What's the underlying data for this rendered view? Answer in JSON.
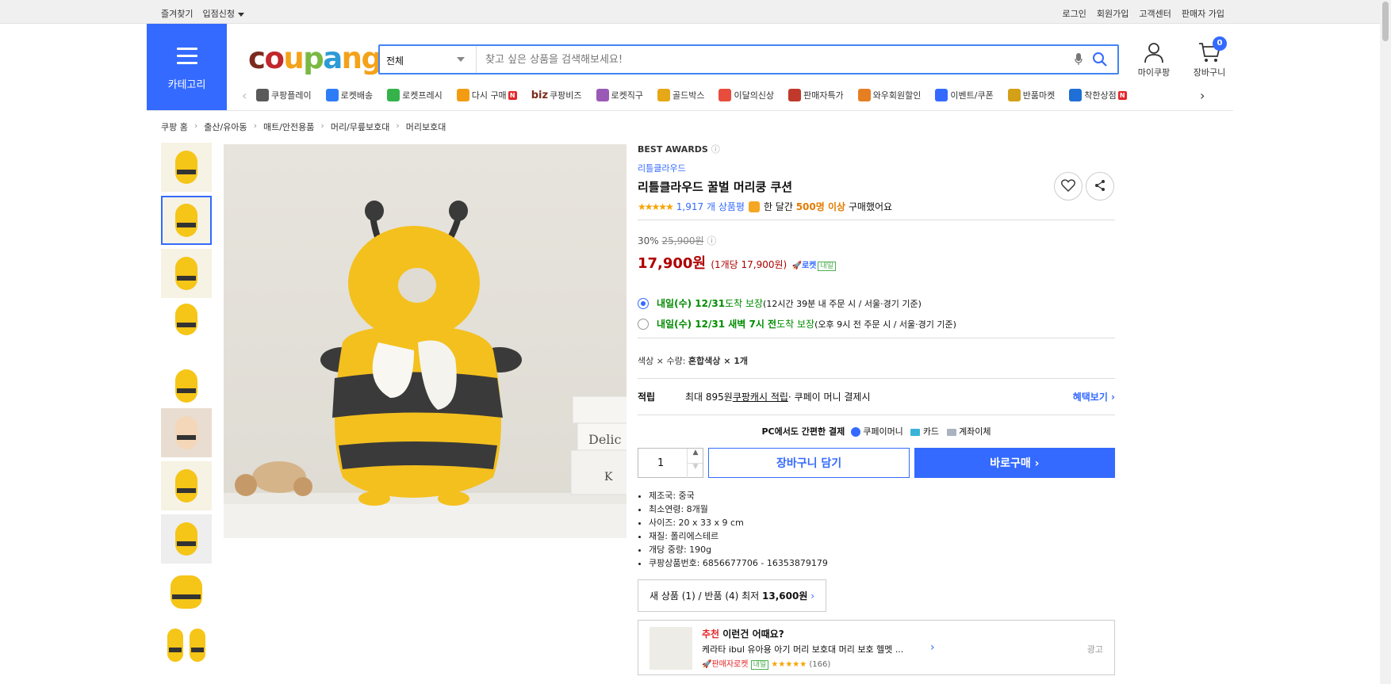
{
  "topbar": {
    "left": [
      "즐겨찾기",
      "입점신청"
    ],
    "right": [
      "로그인",
      "회원가입",
      "고객센터",
      "판매자 가입"
    ]
  },
  "header": {
    "category_label": "카테고리",
    "logo": [
      "c",
      "o",
      "u",
      "p",
      "a",
      "ng"
    ],
    "search": {
      "category": "전체",
      "placeholder": "찾고 싶은 상품을 검색해보세요!"
    },
    "mycoupang": "마이쿠팡",
    "cart": "장바구니",
    "cart_count": "0"
  },
  "nav": [
    {
      "label": "쿠팡플레이",
      "color": "#5a5a5a"
    },
    {
      "label": "로켓배송",
      "color": "#2f7df6"
    },
    {
      "label": "로켓프레시",
      "color": "#35b34a"
    },
    {
      "label": "다시 구매",
      "color": "#f39c12",
      "badge": "N"
    },
    {
      "label": "쿠팡비즈",
      "color": "#222",
      "prefix": "biz"
    },
    {
      "label": "로켓직구",
      "color": "#9b59b6"
    },
    {
      "label": "골드박스",
      "color": "#e6a817"
    },
    {
      "label": "이달의신상",
      "color": "#e74c3c"
    },
    {
      "label": "판매자특가",
      "color": "#c0392b"
    },
    {
      "label": "와우회원할인",
      "color": "#e67e22"
    },
    {
      "label": "이벤트/쿠폰",
      "color": "#346aff"
    },
    {
      "label": "반품마켓",
      "color": "#d4a017"
    },
    {
      "label": "착한상점",
      "color": "#1f6fd6",
      "badge": "N"
    }
  ],
  "breadcrumb": [
    "쿠팡 홈",
    "출산/유아동",
    "매트/안전용품",
    "머리/무릎보호대",
    "머리보호대"
  ],
  "product": {
    "awards": "BEST AWARDS",
    "brand": "리틀클라우드",
    "title": "리틀클라우드 꿀벌 머리쿵 쿠션",
    "stars": "★★★★★",
    "reviews": "1,917 개 상품평",
    "bought_pre": "한 달간 ",
    "bought_hl": "500명 이상",
    "bought_post": " 구매했어요",
    "discount": "30%",
    "original_price": "25,900원",
    "price": "17,900원",
    "unit_price": "(1개당 17,900원)",
    "rocket": "로켓",
    "rocket_tag": "내일",
    "delivery": [
      {
        "date": "내일(수) 12/31",
        "suffix": " 도착 보장",
        "note": " (12시간 39분 내 주문 시 / 서울·경기 기준)",
        "selected": true
      },
      {
        "date": "내일(수) 12/31 새벽 7시 전",
        "suffix": " 도착 보장",
        "note": "(오후 9시 전 주문 시 / 서울·경기 기준)",
        "selected": false
      }
    ],
    "option_label": "색상 × 수량: ",
    "option_value": "혼합색상 × 1개",
    "earn_key": "적립",
    "earn_pre": "최대 895원 ",
    "earn_link": "쿠팡캐시 적립",
    "earn_post": " · 쿠페이 머니 결제시",
    "earn_more": "혜택보기",
    "pc_pay": "PC에서도 간편한 결제",
    "pay_methods": [
      "쿠페이머니",
      "카드",
      "계좌이체"
    ],
    "qty": "1",
    "cart_btn": "장바구니 담기",
    "buy_btn": "바로구매",
    "specs": [
      "제조국: 중국",
      "최소연령: 8개월",
      "사이즈: 20 x 33 x 9 cm",
      "재질: 폴리에스테르",
      "개당 중량: 190g",
      "쿠팡상품번호: 6856677706 - 16353879179"
    ],
    "newused_pre": "새 상품 (1) / 반품 (4) 최저 ",
    "newused_price": "13,600원"
  },
  "recommend": {
    "red": "추천",
    "title": " 이런건 어때요?",
    "item": "케라타 ibul 유아용 아기 머리 보호대 머리 보호 헬멧 ...",
    "seller": "판매자로켓",
    "tag": "내일",
    "stars": "★★★★★",
    "count": "(166)",
    "ad": "광고"
  }
}
